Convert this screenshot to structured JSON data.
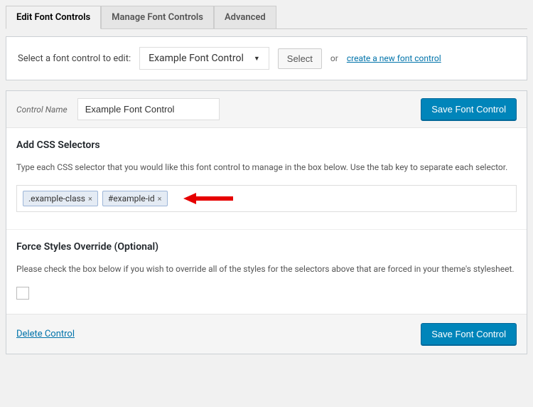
{
  "tabs": {
    "edit": "Edit Font Controls",
    "manage": "Manage Font Controls",
    "advanced": "Advanced"
  },
  "select_panel": {
    "label": "Select a font control to edit:",
    "selected": "Example Font Control",
    "select_btn": "Select",
    "or": "or",
    "create_link": "create a new font control"
  },
  "control_name": {
    "label": "Control Name",
    "value": "Example Font Control"
  },
  "save_btn": "Save Font Control",
  "css_section": {
    "heading": "Add CSS Selectors",
    "desc": "Type each CSS selector that you would like this font control to manage in the box below. Use the tab key to separate each selector.",
    "tags": [
      ".example-class",
      "#example-id"
    ]
  },
  "force_section": {
    "heading": "Force Styles Override (Optional)",
    "desc": "Please check the box below if you wish to override all of the styles for the selectors above that are forced in your theme's stylesheet."
  },
  "delete_link": "Delete Control"
}
